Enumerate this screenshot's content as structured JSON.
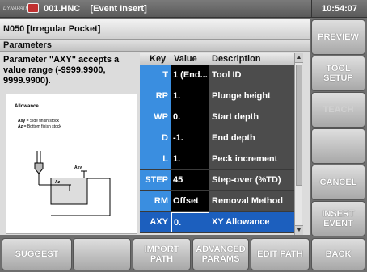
{
  "header": {
    "logo_text": "DYNAPATH",
    "title": "001.HNC    [Event Insert]",
    "time": "10:54:07"
  },
  "panel": {
    "block_title": "N050 [Irregular Pocket]",
    "section_title": "Parameters",
    "description": "Parameter \"AXY\" accepts a value range (-9999.9900, 9999.9900).",
    "illustration": {
      "title": "Allowance",
      "line1_key": "Axy",
      "line1_text": " = Side finish stock",
      "line2_key": "Az",
      "line2_text": " = Bottom finish stock",
      "label_axy": "Axy",
      "label_az": "Az"
    }
  },
  "table": {
    "headers": {
      "key": "Key",
      "value": "Value",
      "description": "Description"
    },
    "rows": [
      {
        "key": "T",
        "value": "1 (End...",
        "description": "Tool ID"
      },
      {
        "key": "RP",
        "value": "1.",
        "description": "Plunge height"
      },
      {
        "key": "WP",
        "value": "0.",
        "description": "Start depth"
      },
      {
        "key": "D",
        "value": "-1.",
        "description": "End depth"
      },
      {
        "key": "L",
        "value": "1.",
        "description": "Peck increment"
      },
      {
        "key": "STEP",
        "value": "45",
        "description": "Step-over (%TD)"
      },
      {
        "key": "RM",
        "value": "Offset",
        "description": "Removal Method"
      },
      {
        "key": "AXY",
        "value": "0.",
        "description": "XY Allowance"
      }
    ],
    "selected_key": "AXY"
  },
  "right_buttons": {
    "preview": "PREVIEW",
    "tool_setup": "TOOL SETUP",
    "teach": "TEACH",
    "blank": "",
    "cancel": "CANCEL",
    "insert_event": "INSERT EVENT"
  },
  "bottom_buttons": {
    "suggest": "SUGGEST",
    "blank": "",
    "import_path": "IMPORT PATH",
    "advanced_params": "ADVANCED PARAMS",
    "edit_path": "EDIT PATH",
    "back": "BACK"
  },
  "colors": {
    "key_blue": "#3a8ee0",
    "selected_row": "#1c5fbe",
    "row_bg": "#4c4c4c",
    "logo_red": "#c03030"
  }
}
